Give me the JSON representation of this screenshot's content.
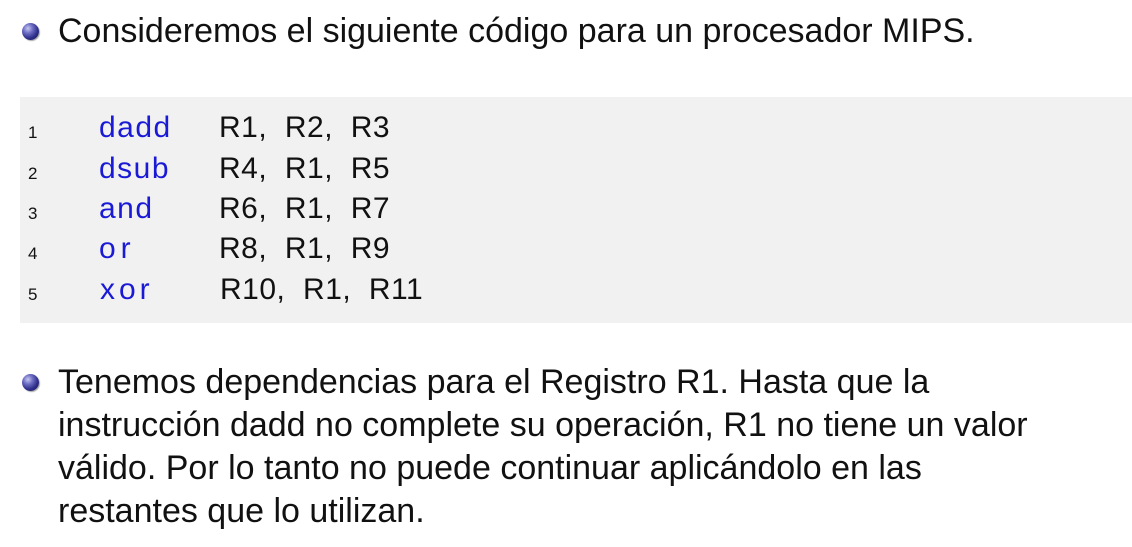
{
  "bullets": {
    "first": "Consideremos el siguiente código para un procesador MIPS.",
    "second_lines": [
      "Tenemos dependencias para el Registro R1. Hasta que la",
      "instrucción dadd no complete su operación, R1 no tiene un valor",
      "válido. Por lo tanto no puede continuar aplicándolo en las",
      "restantes que lo utilizan."
    ]
  },
  "code": {
    "lines": [
      {
        "num": "1",
        "op": "dadd",
        "args": "R1,  R2,  R3"
      },
      {
        "num": "2",
        "op": "dsub",
        "args": "R4,  R1,  R5"
      },
      {
        "num": "3",
        "op": "and",
        "args": "R6,  R1,  R7"
      },
      {
        "num": "4",
        "op": "or",
        "args": "R8,  R1,  R9"
      },
      {
        "num": "5",
        "op": "xor",
        "args": "R10,  R1,  R11"
      }
    ]
  },
  "colors": {
    "keyword": "#1a1ad6",
    "code_background": "#f1f1f1",
    "bullet": "#2e2e8a"
  }
}
